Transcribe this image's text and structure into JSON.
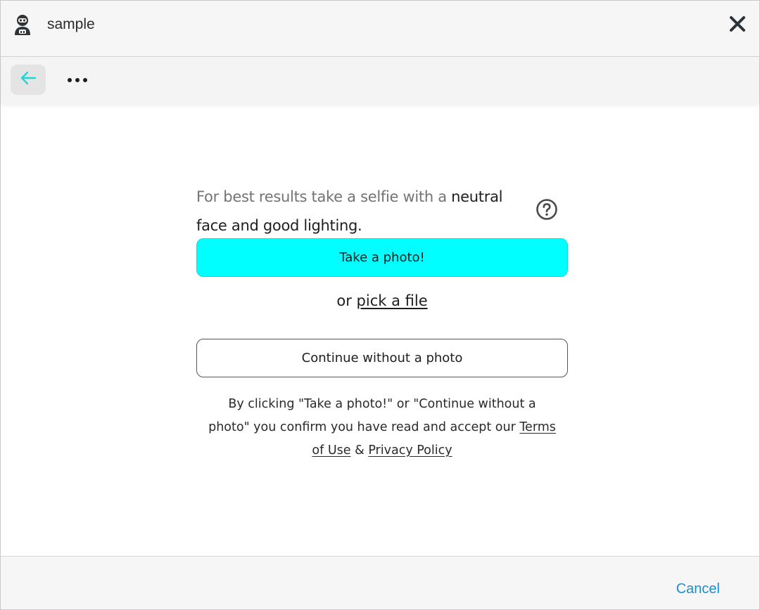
{
  "window": {
    "title": "sample",
    "app_icon": "robot-avatar-icon",
    "close_icon": "close-icon"
  },
  "toolbar": {
    "back_icon": "arrow-left-icon",
    "more_icon": "more-horizontal-icon"
  },
  "main": {
    "intro_part1": "For best results take a selfie with a ",
    "intro_part2": "neutral face and good lighting.",
    "help_icon": "help-circle-icon",
    "take_photo_label": "Take a photo!",
    "pick_prefix": "or ",
    "pick_link": "pick a file",
    "continue_label": "Continue without a photo",
    "consent_text": "By clicking \"Take a photo!\" or \"Continue without a photo\" you confirm you have read and accept our ",
    "terms_link": "Terms of Use",
    "amp": " & ",
    "privacy_link": "Privacy Policy"
  },
  "footer": {
    "cancel_label": "Cancel"
  },
  "colors": {
    "accent_cyan": "#00ffff",
    "back_arrow": "#1fd6d6",
    "cancel_link": "#1a8fcf"
  }
}
